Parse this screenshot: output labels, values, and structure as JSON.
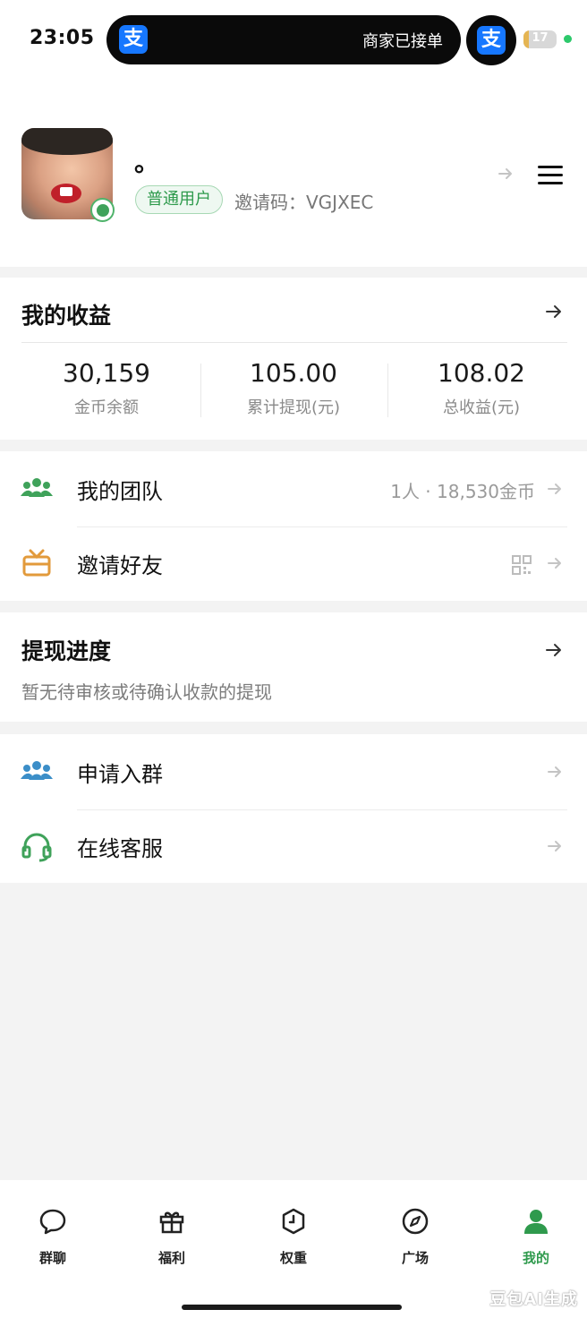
{
  "status_bar": {
    "time": "23:05",
    "island_text": "商家已接单",
    "alipay_glyph": "支",
    "battery": "17",
    "battery_level": 0.17
  },
  "profile": {
    "nickname": "。",
    "role": "普通用户",
    "invite_code": "邀请码：VGJXEC"
  },
  "earnings": {
    "title": "我的收益",
    "stats": [
      {
        "value": "30,159",
        "label": "金币余额"
      },
      {
        "value": "105.00",
        "label": "累计提现(元)"
      },
      {
        "value": "108.02",
        "label": "总收益(元)"
      }
    ]
  },
  "team_card": {
    "rows": [
      {
        "label": "我的团队",
        "value": "1人 · 18,530金币",
        "icon": "team-icon",
        "color": "#3fa25a"
      },
      {
        "label": "邀请好友",
        "value": "",
        "icon": "gift-box-icon",
        "color": "#e29a3b"
      }
    ]
  },
  "withdraw_progress": {
    "title": "提现进度",
    "subtitle": "暂无待审核或待确认收款的提现"
  },
  "support_card": {
    "rows": [
      {
        "label": "申请入群",
        "icon": "group-icon",
        "color": "#3b8ec8"
      },
      {
        "label": "在线客服",
        "icon": "headset-icon",
        "color": "#3fa25a"
      }
    ]
  },
  "tabs": [
    {
      "label": "群聊",
      "icon": "chat-bubble-icon"
    },
    {
      "label": "福利",
      "icon": "gift-icon"
    },
    {
      "label": "权重",
      "icon": "hexagon-clock-icon"
    },
    {
      "label": "广场",
      "icon": "compass-icon"
    },
    {
      "label": "我的",
      "icon": "person-icon",
      "active": true
    }
  ],
  "watermark": "豆包AI生成",
  "colors": {
    "accent_green": "#2f9a4d",
    "alipay_blue": "#1677ff",
    "background": "#f3f3f3"
  }
}
